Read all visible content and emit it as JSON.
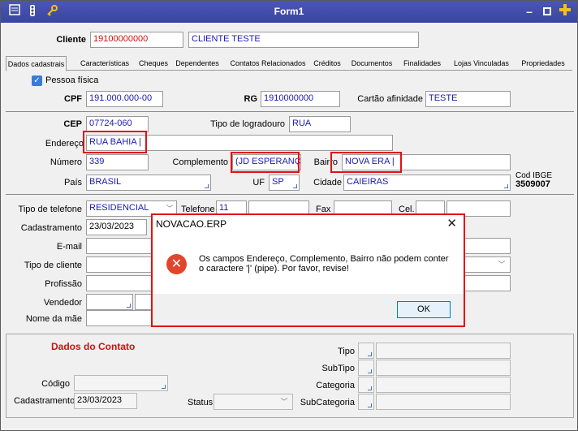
{
  "window": {
    "title": "Form1",
    "icons": [
      "report-icon",
      "traffic-light-icon",
      "key-icon"
    ]
  },
  "cliente": {
    "label": "Cliente",
    "code": "19100000000",
    "name": "CLIENTE TESTE"
  },
  "tabs": [
    "Dados cadastrais",
    "Características",
    "Cheques",
    "Dependentes",
    "Contatos Relacionados",
    "Créditos",
    "Documentos",
    "Finalidades",
    "Lojas Vinculadas",
    "Propriedades"
  ],
  "pessoa": {
    "label": "Pessoa física",
    "checked": true
  },
  "doc": {
    "cpf_label": "CPF",
    "cpf": "191.000.000-00",
    "rg_label": "RG",
    "rg": "1910000000",
    "cartao_label": "Cartão afinidade",
    "cartao": "TESTE"
  },
  "address": {
    "cep_label": "CEP",
    "cep": "07724-060",
    "tipo_logradouro_label": "Tipo de logradouro",
    "tipo_logradouro": "RUA",
    "endereco_label": "Endereço",
    "endereco": "RUA BAHIA |",
    "numero_label": "Número",
    "numero": "339",
    "complemento_label": "Complemento",
    "complemento": "(JD ESPERANÇA",
    "bairro_label": "Bairro",
    "bairro": "NOVA ERA |",
    "pais_label": "País",
    "pais": "BRASIL",
    "uf_label": "UF",
    "uf": "SP",
    "cidade_label": "Cidade",
    "cidade": "CAIEIRAS",
    "ibge_label": "Cod IBGE",
    "ibge": "3509007"
  },
  "contact": {
    "tipo_telefone_label": "Tipo de telefone",
    "tipo_telefone": "RESIDENCIAL",
    "telefone_label": "Telefone",
    "telefone_ddd": "11",
    "fax_label": "Fax",
    "cel_label": "Cel.",
    "cadastramento_label": "Cadastramento",
    "cadastramento": "23/03/2023",
    "email_label": "E-mail",
    "tipo_cliente_label": "Tipo de cliente",
    "profissao_label": "Profissão",
    "vendedor_label": "Vendedor",
    "nome_mae_label": "Nome da mãe"
  },
  "dados_contato": {
    "title": "Dados do Contato",
    "tipo_label": "Tipo",
    "subtipo_label": "SubTipo",
    "categoria_label": "Categoria",
    "subcategoria_label": "SubCategoria",
    "codigo_label": "Código",
    "cadastramento_label": "Cadastramento",
    "cadastramento": "23/03/2023",
    "status_label": "Status"
  },
  "dialog": {
    "title": "NOVACAO.ERP",
    "message": "Os campos Endereço, Complemento, Bairro não podem conter\no caractere '|' (pipe). Por favor, revise!",
    "ok": "OK"
  },
  "colors": {
    "titlebar": "#4b56b5",
    "highlight": "#e01212",
    "value_text": "#1a1ab4",
    "error": "#e1452c",
    "section_title": "#d01010"
  }
}
